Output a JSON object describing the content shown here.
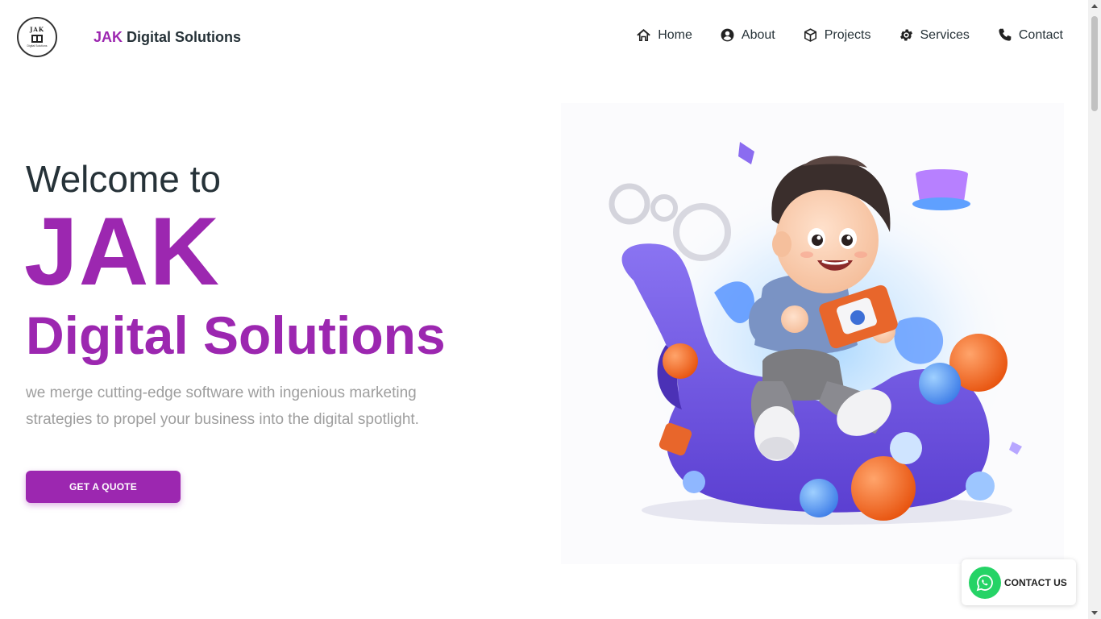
{
  "header": {
    "logo": {
      "top_text": "JAK",
      "bottom_text": "Digital Solutions"
    },
    "brand": {
      "accent": "JAK",
      "rest": " Digital Solutions"
    },
    "nav": [
      {
        "label": "Home",
        "icon": "home-icon"
      },
      {
        "label": "About",
        "icon": "user-circle-icon"
      },
      {
        "label": "Projects",
        "icon": "cube-icon"
      },
      {
        "label": "Services",
        "icon": "gear-icon"
      },
      {
        "label": "Contact",
        "icon": "phone-icon"
      }
    ]
  },
  "hero": {
    "welcome": "Welcome to",
    "title": "JAK",
    "subtitle": "Digital Solutions",
    "description": "we merge cutting-edge software with ingenious marketing strategies to propel your business into the digital spotlight.",
    "cta_label": "GET A QUOTE",
    "illustration": "3d-cartoon-boy-with-tablet-illustration"
  },
  "whatsapp": {
    "label": "CONTACT US",
    "icon": "whatsapp-icon"
  },
  "colors": {
    "accent": "#9c27b0",
    "text": "#263238",
    "muted": "#9e9e9e",
    "whatsapp": "#25d366"
  }
}
